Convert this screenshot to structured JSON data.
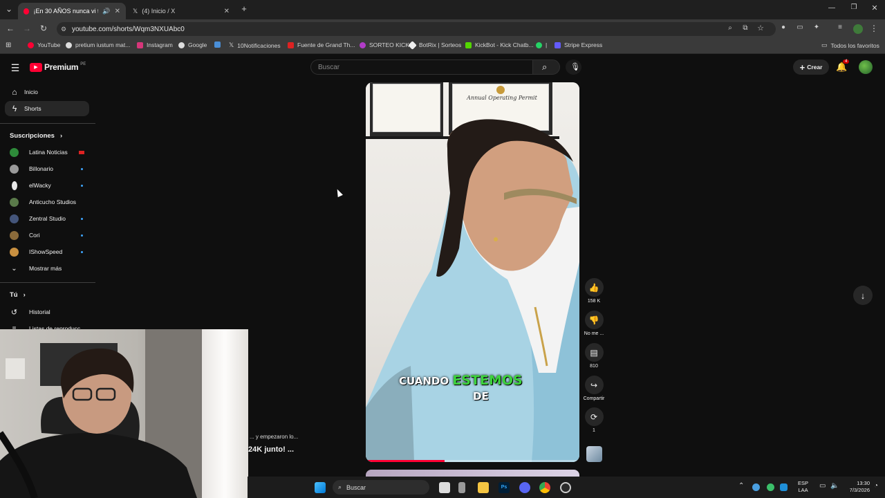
{
  "browser": {
    "tabs": [
      {
        "title": "¡En 30 AÑOS nunca vi tanta",
        "active": true
      },
      {
        "title": "(4) Inicio / X",
        "active": false
      }
    ],
    "url": "youtube.com/shorts/Wqm3NXUAbc0",
    "bookmarks": [
      "YouTube",
      "pretium iustum mat...",
      "Instagram",
      "Google",
      "10Notificaciones",
      "Fuente de Grand Th...",
      "SORTEO KICK",
      "BotRix | Sorteos",
      "KickBot - Kick Chatb...",
      "|",
      "Stripe Express"
    ],
    "all_bookmarks": "Todos los favoritos"
  },
  "youtube": {
    "logo_text": "Premium",
    "region": "PE",
    "search_placeholder": "Buscar",
    "create_label": "Crear",
    "notification_count": "4"
  },
  "sidebar": {
    "main": [
      {
        "label": "Inicio",
        "icon": "home-icon"
      },
      {
        "label": "Shorts",
        "icon": "shorts-icon",
        "active": true
      }
    ],
    "subscriptions_title": "Suscripciones",
    "subscriptions": [
      {
        "label": "Latina Noticias",
        "color": "#2e8b3a"
      },
      {
        "label": "Billonario",
        "color": "#9a9a9a"
      },
      {
        "label": "elWacky",
        "color": "#e8e8e8"
      },
      {
        "label": "Anticucho Studios",
        "color": "#5a7a4a"
      },
      {
        "label": "Zentral Studio",
        "color": "#44557a"
      },
      {
        "label": "Cori",
        "color": "#8a6a3a"
      },
      {
        "label": "IShowSpeed",
        "color": "#c89040"
      }
    ],
    "show_more": "Mostrar más",
    "you_title": "Tú",
    "you_items": [
      {
        "label": "Historial"
      },
      {
        "label": "Listas de reproducc..."
      }
    ]
  },
  "short": {
    "caption_words": [
      "CUANDO",
      "ESTEMOS",
      "DE"
    ],
    "wall_sign": "Annual Operating Permit",
    "progress": 0.37,
    "likes": "158 K",
    "dislike_label": "No me ...",
    "comments": "810",
    "share_label": "Compartir",
    "remix_count": "1"
  },
  "overlay_text": {
    "line1": "... y empezaron lo...",
    "line2": "24K junto! ..."
  },
  "taskbar": {
    "search_placeholder": "Buscar",
    "lang": "ESP",
    "lang2": "LAA",
    "time": "13:30",
    "date": "7/3/2026"
  }
}
